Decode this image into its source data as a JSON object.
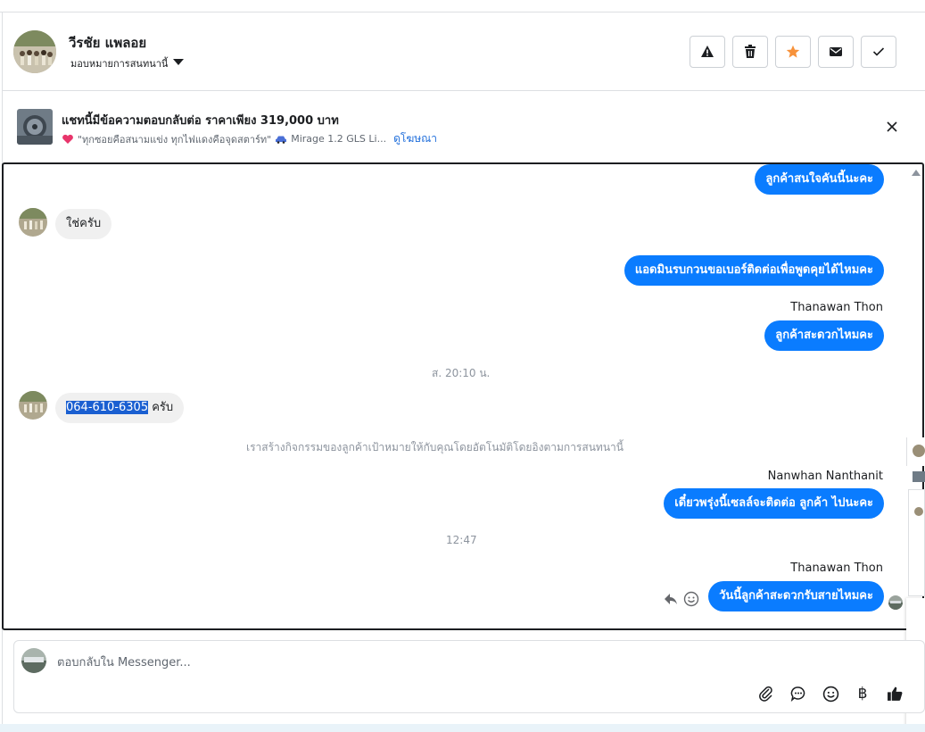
{
  "header": {
    "name": "วีรชัย แพลอย",
    "assign_label": "มอบหมายการสนทนานี้",
    "actions": [
      "spam",
      "delete",
      "star",
      "mark-unread",
      "done"
    ],
    "star_color": "#f7923b"
  },
  "banner": {
    "title": "แชทนี้มีข้อความตอบกลับต่อ ราคาเพียง 319,000 บาท",
    "subtitle": "\"ทุกซอยคือสนามแข่ง ทุกไฟแดงคือจุดสตาร์ท\"",
    "car_text": "Mirage 1.2 GLS Li...",
    "link": "ดูโฆษณา"
  },
  "messages": {
    "m1": "ลูกค้าสนใจคันนี้นะคะ",
    "m2": "ใช่ครับ",
    "m3": "แอดมินรบกวนขอเบอร์ติดต่อเพื่อพูดคุยได้ไหมคะ",
    "sender1": "Thanawan Thon",
    "m4": "ลูกค้าสะดวกไหมคะ",
    "time1": "ส. 20:10 น.",
    "m5_phone": "064-610-6305",
    "m5_suffix": " ครับ",
    "system": "เราสร้างกิจกรรมของลูกค้าเป้าหมายให้กับคุณโดยอัตโนมัติโดยอิงตามการสนทนานี้",
    "sender2": "Nanwhan Nanthanit",
    "m6": "เดี๋ยวพรุ่งนี้เซลล์จะติดต่อ ลูกค้า ไปนะคะ",
    "time2": "12:47",
    "sender3": "Thanawan Thon",
    "m7": "วันนี้ลูกค้าสะดวกรับสายไหมคะ"
  },
  "composer": {
    "placeholder": "ตอบกลับใน Messenger...",
    "baht_symbol": "฿"
  },
  "colors": {
    "outgoing_bubble": "#0a7cff",
    "incoming_bubble": "#f0f0f0",
    "link": "#216fdb"
  }
}
